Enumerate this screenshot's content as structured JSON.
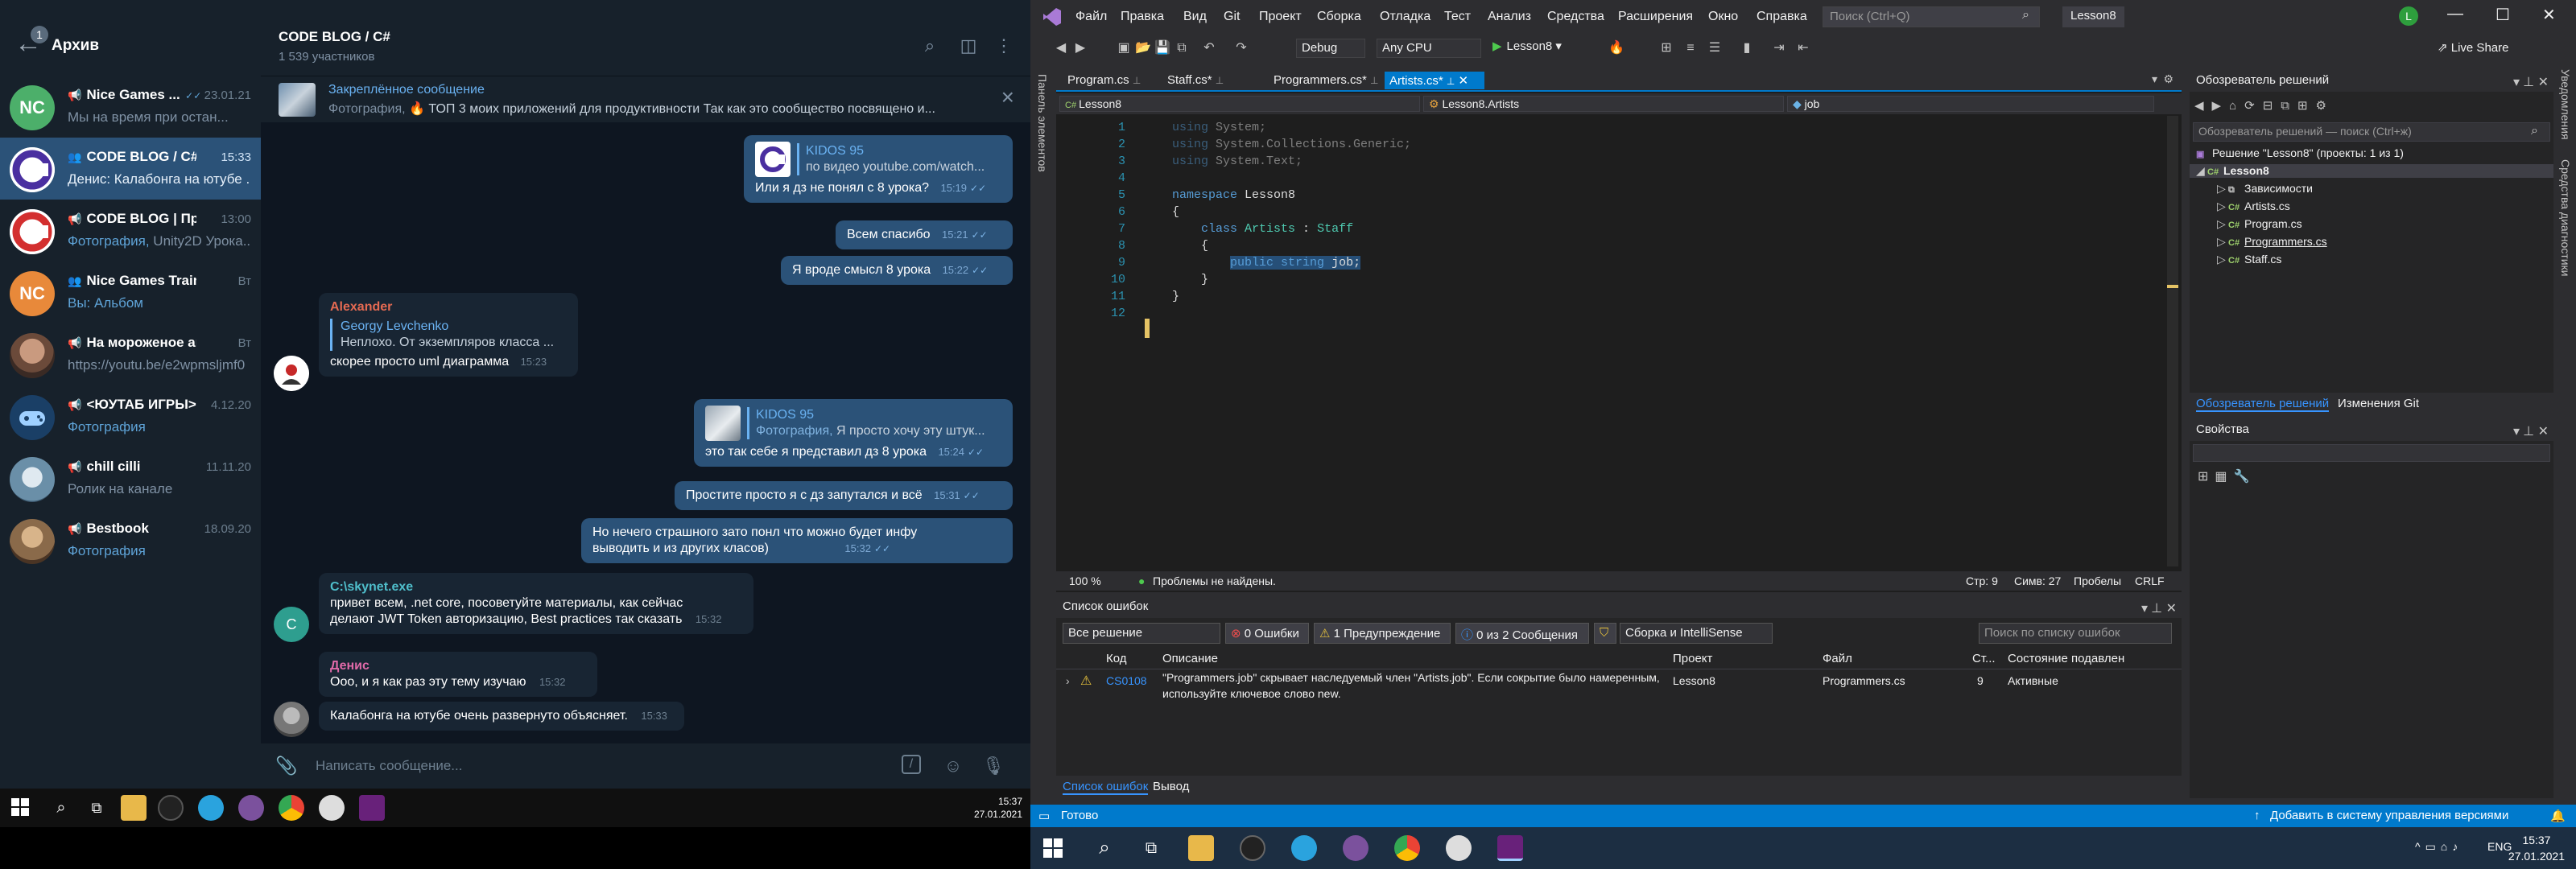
{
  "telegram": {
    "sidebar": {
      "archive_badge": "1",
      "archive_title": "Архив",
      "chats": [
        {
          "avatar": "NC",
          "avatar_color": "#4caf6a",
          "name": "Nice Games ...",
          "time": "23.01.21",
          "preview": "Мы на время при остан..."
        },
        {
          "avatar": "",
          "avatar_color": "#2b2b6b",
          "name": "CODE BLOG / C#",
          "time": "15:33",
          "preview": "Денис: Калабонга на ютубе ..."
        },
        {
          "avatar": "",
          "avatar_color": "#d32f2f",
          "name": "CODE BLOG | Про...",
          "time": "13:00",
          "preview_hl": "Фотография,",
          "preview": " Unity2D Урока..."
        },
        {
          "avatar": "NC",
          "avatar_color": "#e8893a",
          "name": "Nice Games Traini...",
          "time": "Вт",
          "preview_hl": "Вы: Альбом",
          "preview": ""
        },
        {
          "avatar": "",
          "avatar_color": "#7a5a4a",
          "name": "На мороженое актеру",
          "time": "Вт",
          "preview": "https://youtu.be/e2wpmsljmf0"
        },
        {
          "avatar": "",
          "avatar_color": "#1a3f66",
          "name": "<ЮУТАБ ИГРЫ>",
          "time": "4.12.20",
          "preview_hl": "Фотография",
          "preview": ""
        },
        {
          "avatar": "",
          "avatar_color": "#6a8fa8",
          "name": "chill cilli",
          "time": "11.11.20",
          "preview": "Ролик на канале"
        },
        {
          "avatar": "",
          "avatar_color": "#8a6a4a",
          "name": "Bestbook",
          "time": "18.09.20",
          "preview_hl": "Фотография",
          "preview": ""
        }
      ]
    },
    "chat": {
      "title": "CODE BLOG / C#",
      "subtitle": "1 539 участников",
      "pinned_title": "Закреплённое сообщение",
      "pinned_hl": "Фотография,",
      "pinned_text": " 🔥 ТОП 3 моих приложений для продуктивности  Так как это сообщество посвящено и...",
      "compose_placeholder": "Написать сообщение...",
      "messages": {
        "m1_qname": "KIDOS 95",
        "m1_qtext": "по видео youtube.com/watch...",
        "m1_text": "Или я дз не понял с 8 урока?",
        "m1_time": "15:19",
        "m2_text": "Всем спасибо",
        "m2_time": "15:21",
        "m3_text": "Я вроде смысл 8 урока",
        "m3_time": "15:22",
        "m4_name": "Alexander",
        "m4_qname": "Georgy Levchenko",
        "m4_qtext": "Неплохо. От экземпляров класса ...",
        "m4_text": "скорее просто uml диаграмма",
        "m4_time": "15:23",
        "m5_qname": "KIDOS 95",
        "m5_qhl": "Фотография,",
        "m5_qtext": " Я просто хочу эту штук...",
        "m5_text": "это так себе я представил дз 8 урока",
        "m5_time": "15:24",
        "m6_text": "Простите просто я с дз запутался и всё",
        "m6_time": "15:31",
        "m7_line1": "Но нечего страшного зато понл что можно будет инфу",
        "m7_line2": "выводить и из  других класов)",
        "m7_time": "15:32",
        "m8_name": "C:\\skynet.exe",
        "m8_avatar": "C",
        "m8_line1": "привет всем, .net core, посоветуйте материалы, как сейчас",
        "m8_line2": "делают JWT Token авторизацию, Best practices так сказать",
        "m8_time": "15:32",
        "m9_name": "Денис",
        "m9_text": "Ооо, и я как раз эту тему изучаю",
        "m9_time": "15:32",
        "m10_text": "Калабонга на ютубе очень развернуто объясняет.",
        "m10_time": "15:33"
      }
    }
  },
  "left_taskbar": {
    "time": "15:37",
    "date": "27.01.2021"
  },
  "vs": {
    "menu": [
      "Файл",
      "Правка",
      "Вид",
      "Git",
      "Проект",
      "Сборка",
      "Отладка",
      "Тест",
      "Анализ",
      "Средства",
      "Расширения",
      "Окно",
      "Справка"
    ],
    "search_placeholder": "Поиск (Ctrl+Q)",
    "project_tag": "Lesson8",
    "user_initial": "L",
    "live_share": "Live Share",
    "config": "Debug",
    "platform": "Any CPU",
    "run_target": "Lesson8",
    "side_panel": "Панель элементов",
    "tabs": [
      "Program.cs",
      "Staff.cs*",
      "Programmers.cs*",
      "Artists.cs*"
    ],
    "nav": {
      "project": "Lesson8",
      "class": "Lesson8.Artists",
      "member": "job"
    },
    "code_lines": [
      {
        "n": "1",
        "parts": [
          {
            "t": "using",
            "c": "kw dim"
          },
          {
            "t": " System;",
            "c": "dim"
          }
        ]
      },
      {
        "n": "2",
        "parts": [
          {
            "t": "using",
            "c": "kw dim"
          },
          {
            "t": " System.Collections.Generic;",
            "c": "dim"
          }
        ]
      },
      {
        "n": "3",
        "parts": [
          {
            "t": "using",
            "c": "kw dim"
          },
          {
            "t": " System.Text;",
            "c": "dim"
          }
        ]
      },
      {
        "n": "4",
        "parts": []
      },
      {
        "n": "5",
        "parts": [
          {
            "t": "namespace",
            "c": "kw"
          },
          {
            "t": " Lesson8",
            "c": ""
          }
        ]
      },
      {
        "n": "6",
        "parts": [
          {
            "t": "{",
            "c": ""
          }
        ]
      },
      {
        "n": "7",
        "parts": [
          {
            "t": "    class",
            "c": "kw"
          },
          {
            "t": " ",
            "c": ""
          },
          {
            "t": "Artists",
            "c": "ty"
          },
          {
            "t": " : ",
            "c": ""
          },
          {
            "t": "Staff",
            "c": "ty"
          }
        ]
      },
      {
        "n": "8",
        "parts": [
          {
            "t": "    {",
            "c": ""
          }
        ]
      },
      {
        "n": "9",
        "parts": [
          {
            "t": "        ",
            "c": ""
          },
          {
            "t": "public",
            "c": "kw sel"
          },
          {
            "t": " ",
            "c": "sel"
          },
          {
            "t": "string",
            "c": "kw sel"
          },
          {
            "t": " job;",
            "c": "sel"
          }
        ]
      },
      {
        "n": "10",
        "parts": [
          {
            "t": "    }",
            "c": ""
          }
        ]
      },
      {
        "n": "11",
        "parts": [
          {
            "t": "}",
            "c": ""
          }
        ]
      },
      {
        "n": "12",
        "parts": []
      }
    ],
    "editor_status": {
      "zoom": "100 %",
      "issues": "Проблемы не найдены.",
      "line": "Стр: 9",
      "col": "Симв: 27",
      "spaces": "Пробелы",
      "eol": "CRLF"
    },
    "error_list": {
      "title": "Список ошибок",
      "scope": "Все решение",
      "errors": "0 Ошибки",
      "warnings": "1 Предупреждение",
      "messages": "0 из 2 Сообщения",
      "build_filter": "Сборка и IntelliSense",
      "search_placeholder": "Поиск по списку ошибок",
      "columns": [
        "Код",
        "Описание",
        "Проект",
        "Файл",
        "Ст...",
        "Состояние подавлен"
      ],
      "row": {
        "code": "CS0108",
        "desc1": "\"Programmers.job\" скрывает наследуемый член \"Artists.job\". Если сокрытие было намеренным,",
        "desc2": "используйте ключевое слово new.",
        "project": "Lesson8",
        "file": "Programmers.cs",
        "line": "9",
        "state": "Активные"
      },
      "bottom_tabs": [
        "Список ошибок",
        "Вывод"
      ]
    },
    "solution_explorer": {
      "title": "Обозреватель решений",
      "search_placeholder": "Обозреватель решений — поиск (Ctrl+ж)",
      "solution": "Решение \"Lesson8\" (проекты: 1 из 1)",
      "project": "Lesson8",
      "items": [
        "Зависимости",
        "Artists.cs",
        "Program.cs",
        "Programmers.cs",
        "Staff.cs"
      ],
      "tabs": [
        "Обозреватель решений",
        "Изменения Git"
      ]
    },
    "properties_title": "Свойства",
    "right_strip": [
      "Уведомления",
      "Средства диагностики"
    ],
    "status": {
      "ready": "Готово",
      "vcs": "Добавить в систему управления версиями"
    }
  },
  "right_taskbar": {
    "lang": "ENG",
    "time": "15:37",
    "date": "27.01.2021"
  }
}
